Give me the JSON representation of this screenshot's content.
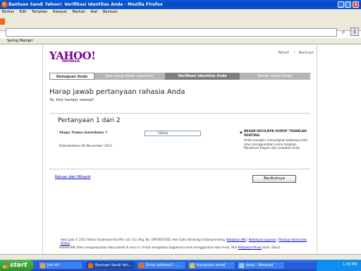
{
  "window": {
    "title": "Bantuan Sandi Yahoo!: Verifikasi Identitas Anda - Mozilla Firefox",
    "minimize": "_",
    "maximize": "□",
    "close": "x"
  },
  "menu": [
    "Berkas",
    "Edit",
    "Tampilan",
    "Riwayat",
    "Markah",
    "Alat",
    "Bantuan"
  ],
  "toolbar": {
    "search_icon": "⌕",
    "download_icon": "⇩"
  },
  "bookmarks": {
    "item": "Sering Mampir"
  },
  "page": {
    "logo": "YAHOO!",
    "logo_sub": "INDONESIA",
    "toplinks": [
      "Yahoo!",
      "Bantuan"
    ],
    "steps": [
      "Kemajuan Anda",
      "Apa yang Anda lupakan?",
      "Verifikasi Identitas Anda",
      "Reset sandi Anda"
    ],
    "heading": "Harap jawab pertanyaan rahasia Anda",
    "subheading": "Ya, kita hampir selesai!",
    "question_title": "Pertanyaan 1 dari 2",
    "question_label": "Siapa Nama musuhmu ?",
    "answer_value": "Hitler",
    "added": "Ditambahkan:02 November 2011",
    "tip_icon": "◆",
    "tip_title": "BESAR KECILNYA HURUF TIDAKLAH PENTING",
    "tip_body": "Anda mungkin menyingkat beberapa kata atau menggunakan nama lengkap. Masukkan bagian dari jawaban Anda",
    "exit_link": "Keluar dari Wizard",
    "next_button": "Berikutnya",
    "footer1": "Hak Cipta © 2011 Yahoo! Southeast Asia Pte. Ltd. (Co. Reg. No. 199700735D). Hak Cipta dilindungi Undang-Undang.",
    "footer1_links": [
      "Kebijakan HKI",
      "Ketentuan Layanan",
      "Panduan Komunitas Online"
    ],
    "footer2": "PERHATIAN: Kami mengumpulkan data pribadi di situs ini. Untuk mengetahui bagaimana kami menggunakan data Anda, lihat",
    "footer2_link": "Kebijakan Privasi",
    "footer2_end": "kami. (Baru)"
  },
  "taskbar": {
    "start": "start",
    "tasks": [
      {
        "label": "Join Air",
        "color": "#e8a33b"
      },
      {
        "label": "Bantuan Sandi Yah...",
        "color": "#e46c1d",
        "active": true
      },
      {
        "label": "Email adriene3 - ...",
        "color": "#e46c1d"
      },
      {
        "label": "Kumpulan email",
        "color": "#e6c13b"
      },
      {
        "label": "dody - Notepad",
        "color": "#9fc3e8"
      }
    ],
    "clock": "1:39 PM"
  }
}
